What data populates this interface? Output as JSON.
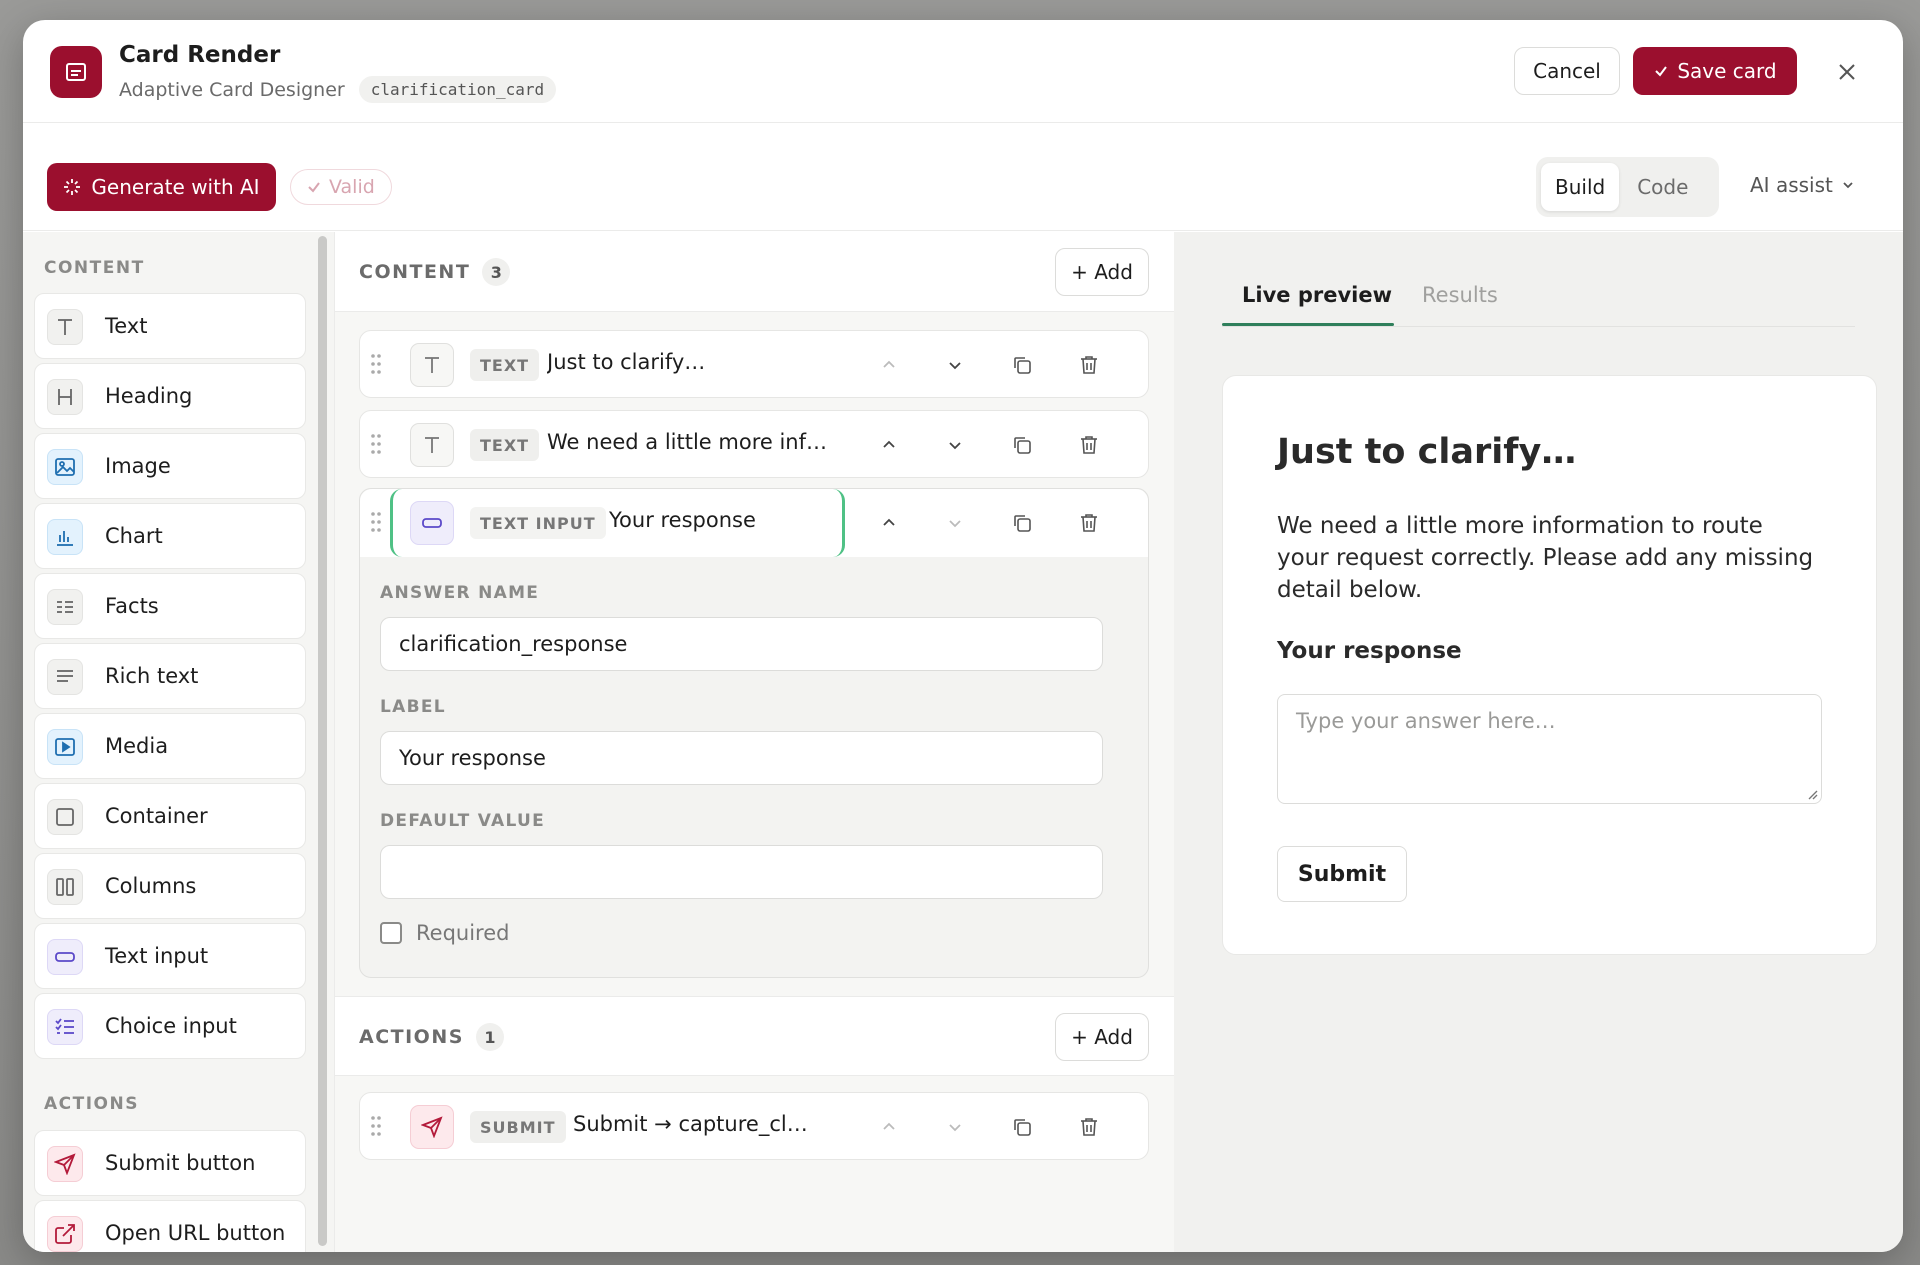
{
  "header": {
    "title": "Card Render",
    "subtitle": "Adaptive Card Designer",
    "card_id": "clarification_card",
    "cancel_label": "Cancel",
    "save_label": "Save card"
  },
  "toolbar": {
    "generate_label": "Generate with AI",
    "valid_label": "Valid",
    "view_modes": [
      "Build",
      "Code"
    ],
    "active_mode": "Build",
    "ai_assist_label": "AI assist"
  },
  "palette": {
    "content_heading": "CONTENT",
    "content_items": [
      {
        "label": "Text",
        "icon": "text-icon"
      },
      {
        "label": "Heading",
        "icon": "heading-icon"
      },
      {
        "label": "Image",
        "icon": "image-icon"
      },
      {
        "label": "Chart",
        "icon": "chart-icon"
      },
      {
        "label": "Facts",
        "icon": "facts-icon"
      },
      {
        "label": "Rich text",
        "icon": "rich-text-icon"
      },
      {
        "label": "Media",
        "icon": "media-icon"
      },
      {
        "label": "Container",
        "icon": "container-icon"
      },
      {
        "label": "Columns",
        "icon": "columns-icon"
      },
      {
        "label": "Text input",
        "icon": "text-input-icon"
      },
      {
        "label": "Choice input",
        "icon": "choice-input-icon"
      }
    ],
    "actions_heading": "ACTIONS",
    "action_items": [
      {
        "label": "Submit button",
        "icon": "submit-icon"
      },
      {
        "label": "Open URL button",
        "icon": "open-url-icon"
      }
    ]
  },
  "content": {
    "heading": "CONTENT",
    "count": "3",
    "add_label": "+ Add",
    "rows": [
      {
        "type": "TEXT",
        "text": "Just to clarify…"
      },
      {
        "type": "TEXT",
        "text": "We need a little more inf…"
      },
      {
        "type": "TEXT INPUT",
        "text": "Your response"
      }
    ],
    "editor": {
      "answer_name_label": "ANSWER NAME",
      "answer_name_value": "clarification_response",
      "label_label": "LABEL",
      "label_value": "Your response",
      "default_value_label": "DEFAULT VALUE",
      "default_value_value": "",
      "required_label": "Required"
    }
  },
  "actions": {
    "heading": "ACTIONS",
    "count": "1",
    "add_label": "+ Add",
    "rows": [
      {
        "type": "SUBMIT",
        "text": "Submit → capture_cl…"
      }
    ]
  },
  "preview": {
    "tabs": [
      "Live preview",
      "Results"
    ],
    "active_tab": "Live preview",
    "card": {
      "title": "Just to clarify…",
      "body": "We need a little more information to route your request correctly. Please add any missing detail below.",
      "input_label": "Your response",
      "input_placeholder": "Type your answer here…",
      "submit_label": "Submit"
    }
  },
  "colors": {
    "brand": "#9b0f2e",
    "selected_outline": "#4fc185",
    "tab_underline": "#2f7f5b"
  }
}
